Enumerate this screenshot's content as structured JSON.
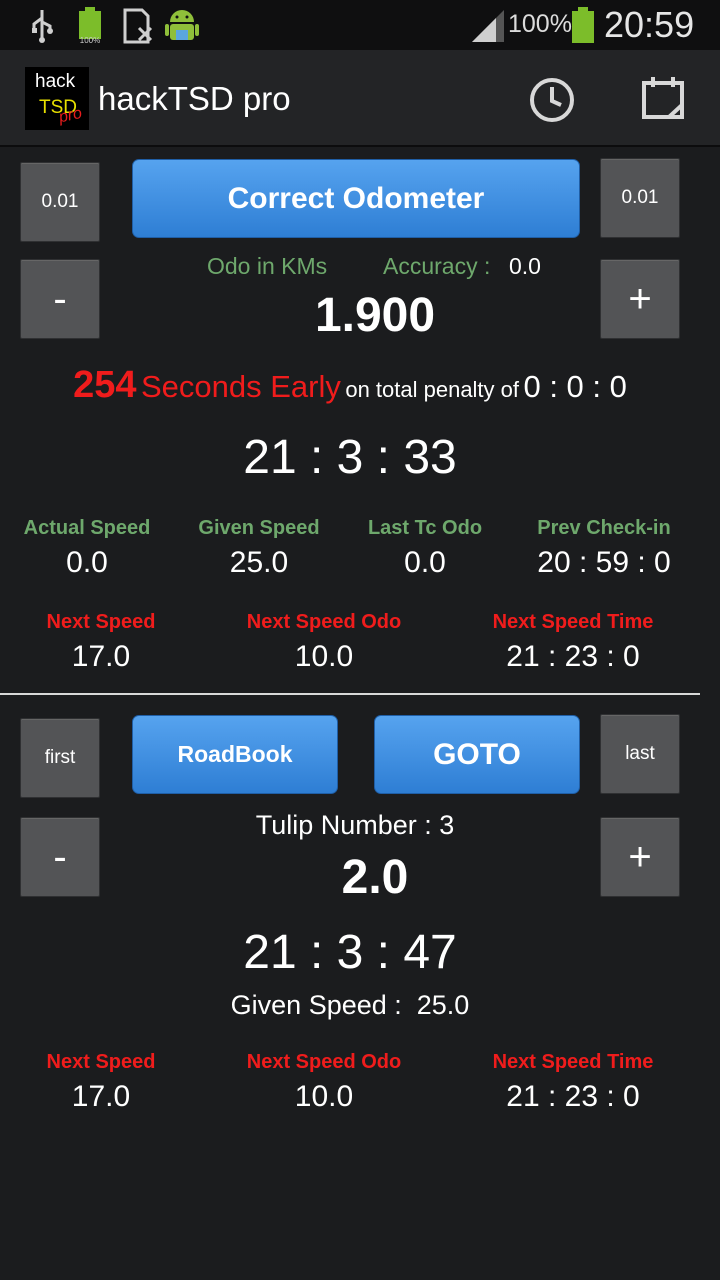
{
  "status_bar": {
    "battery_percent": "100%",
    "time": "20:59",
    "icons": [
      "usb-icon",
      "battery-full-icon",
      "sim-missing-icon",
      "android-icon",
      "signal-icon",
      "battery-icon"
    ]
  },
  "action_bar": {
    "logo_line1": "hack",
    "logo_line2": "TSD",
    "logo_line3": "pro",
    "title": "hackTSD pro",
    "icons": [
      "clock-icon",
      "calendar-icon"
    ]
  },
  "odometer": {
    "step_left": "0.01",
    "step_right": "0.01",
    "correct_label": "Correct Odometer",
    "minus_label": "-",
    "plus_label": "+",
    "odo_unit_label": "Odo in KMs",
    "accuracy_label": "Accuracy :",
    "accuracy_value": "0.0",
    "odo_value": "1.900"
  },
  "status": {
    "seconds": "254",
    "seconds_text": "Seconds Early",
    "penalty_text": "on total penalty of",
    "penalty_value": "0 : 0 : 0",
    "current_time": "21 : 3 : 33"
  },
  "stats": {
    "actual_speed_label": "Actual Speed",
    "actual_speed_value": "0.0",
    "given_speed_label": "Given Speed",
    "given_speed_value": "25.0",
    "last_tc_odo_label": "Last Tc Odo",
    "last_tc_odo_value": "0.0",
    "prev_checkin_label": "Prev Check-in",
    "prev_checkin_value": "20 : 59 : 0"
  },
  "next_top": {
    "next_speed_label": "Next Speed",
    "next_speed_value": "17.0",
    "next_speed_odo_label": "Next Speed Odo",
    "next_speed_odo_value": "10.0",
    "next_speed_time_label": "Next Speed Time",
    "next_speed_time_value": "21 : 23 : 0"
  },
  "roadbook": {
    "first_label": "first",
    "roadbook_label": "RoadBook",
    "goto_label": "GOTO",
    "last_label": "last",
    "minus_label": "-",
    "plus_label": "+",
    "tulip_text": "Tulip Number : 3",
    "tulip_distance": "2.0",
    "tulip_time": "21 : 3 : 47",
    "given_speed_text": "Given Speed :  25.0"
  },
  "next_bottom": {
    "next_speed_label": "Next Speed",
    "next_speed_value": "17.0",
    "next_speed_odo_label": "Next Speed Odo",
    "next_speed_odo_value": "10.0",
    "next_speed_time_label": "Next Speed Time",
    "next_speed_time_value": "21 : 23 : 0"
  },
  "colors": {
    "background": "#1b1c1e",
    "accent_blue": "#3d8ee3",
    "label_green": "#6ea86c",
    "alert_red": "#f01c1c"
  }
}
